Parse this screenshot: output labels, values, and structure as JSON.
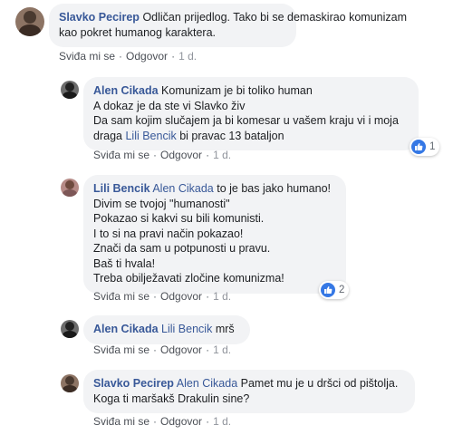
{
  "colors": {
    "author": "#385898",
    "bubble": "#f2f3f5",
    "like": "#3578e5",
    "meta": "#90949c"
  },
  "actions": {
    "like": "Sviđa mi se",
    "reply": "Odgovor",
    "sep": "·"
  },
  "comments": [
    {
      "author": "Slavko Pecirep",
      "lines": [
        "Odličan prijedlog. Tako bi se demaskirao komunizam",
        "kao pokret humanog karaktera."
      ],
      "time": "1 d."
    },
    {
      "author": "Alen Cikada",
      "lines": [
        "Komunizam je bi toliko human",
        "A dokaz je da ste vi Slavko živ",
        "Da sam kojim slučajem ja bi komesar u vašem kraju vi i moja"
      ],
      "line4_pre": "draga",
      "line4_mention": "Lili Bencik",
      "line4_post": "bi pravac 13 bataljon",
      "time": "1 d.",
      "reactions": {
        "icon": "like-icon",
        "count": "1"
      }
    },
    {
      "author": "Lili Bencik",
      "mention": "Alen Cikada",
      "first_line": "to je bas jako humano!",
      "lines": [
        "Divim se tvojoj \"humanosti\"",
        "Pokazao si kakvi su bili komunisti.",
        "I to si na pravi način pokazao!",
        "Znači da sam u potpunosti u pravu.",
        "Baš ti hvala!",
        "Treba obilježavati zločine komunizma!"
      ],
      "time": "1 d.",
      "reactions": {
        "icon": "like-icon",
        "count": "2"
      }
    },
    {
      "author": "Alen Cikada",
      "mention": "Lili Bencik",
      "first_line": "mrš",
      "time": "1 d."
    },
    {
      "author": "Slavko Pecirep",
      "mention": "Alen Cikada",
      "first_line": "Pamet mu je u dršci od pištolja.",
      "lines": [
        "Koga ti maršakš Drakulin sine?"
      ],
      "time": "1 d."
    }
  ]
}
